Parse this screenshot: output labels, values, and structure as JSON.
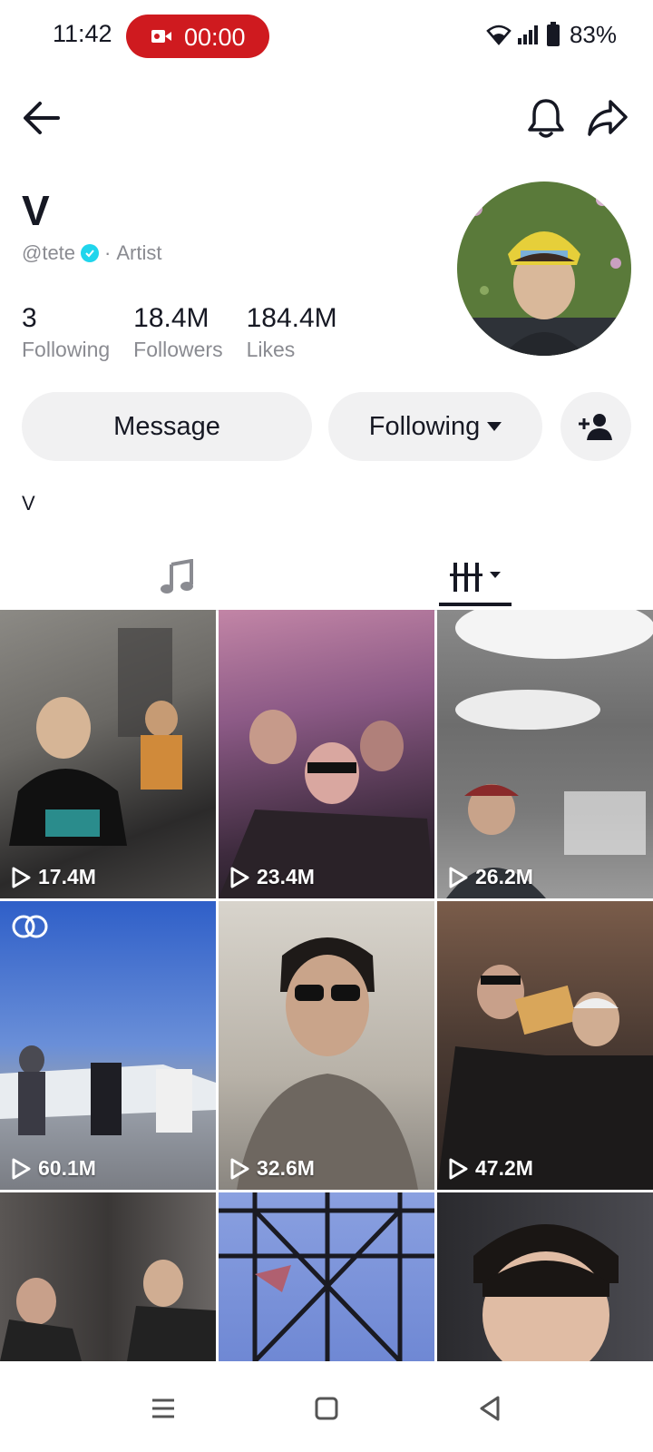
{
  "status_bar": {
    "time": "11:42",
    "recording_time": "00:00",
    "battery": "83%",
    "recording_color": "#cf1a1f"
  },
  "top_nav": {
    "back_icon": "back-arrow-icon",
    "bell_icon": "bell-icon",
    "share_icon": "share-icon"
  },
  "profile": {
    "display_name": "V",
    "handle": "@tete",
    "separator": "·",
    "category": "Artist",
    "bio": "V"
  },
  "stats": [
    {
      "value": "3",
      "label": "Following"
    },
    {
      "value": "18.4M",
      "label": "Followers"
    },
    {
      "value": "184.4M",
      "label": "Likes"
    }
  ],
  "actions": {
    "message_label": "Message",
    "following_label": "Following"
  },
  "tabs": [
    {
      "icon": "music-note-icon"
    },
    {
      "icon": "grid-filter-icon",
      "active": true
    }
  ],
  "videos": [
    {
      "views": "17.4M"
    },
    {
      "views": "23.4M"
    },
    {
      "views": "26.2M"
    },
    {
      "views": "60.1M",
      "collab": true
    },
    {
      "views": "32.6M"
    },
    {
      "views": "47.2M"
    },
    {
      "views": ""
    },
    {
      "views": ""
    },
    {
      "views": ""
    }
  ]
}
